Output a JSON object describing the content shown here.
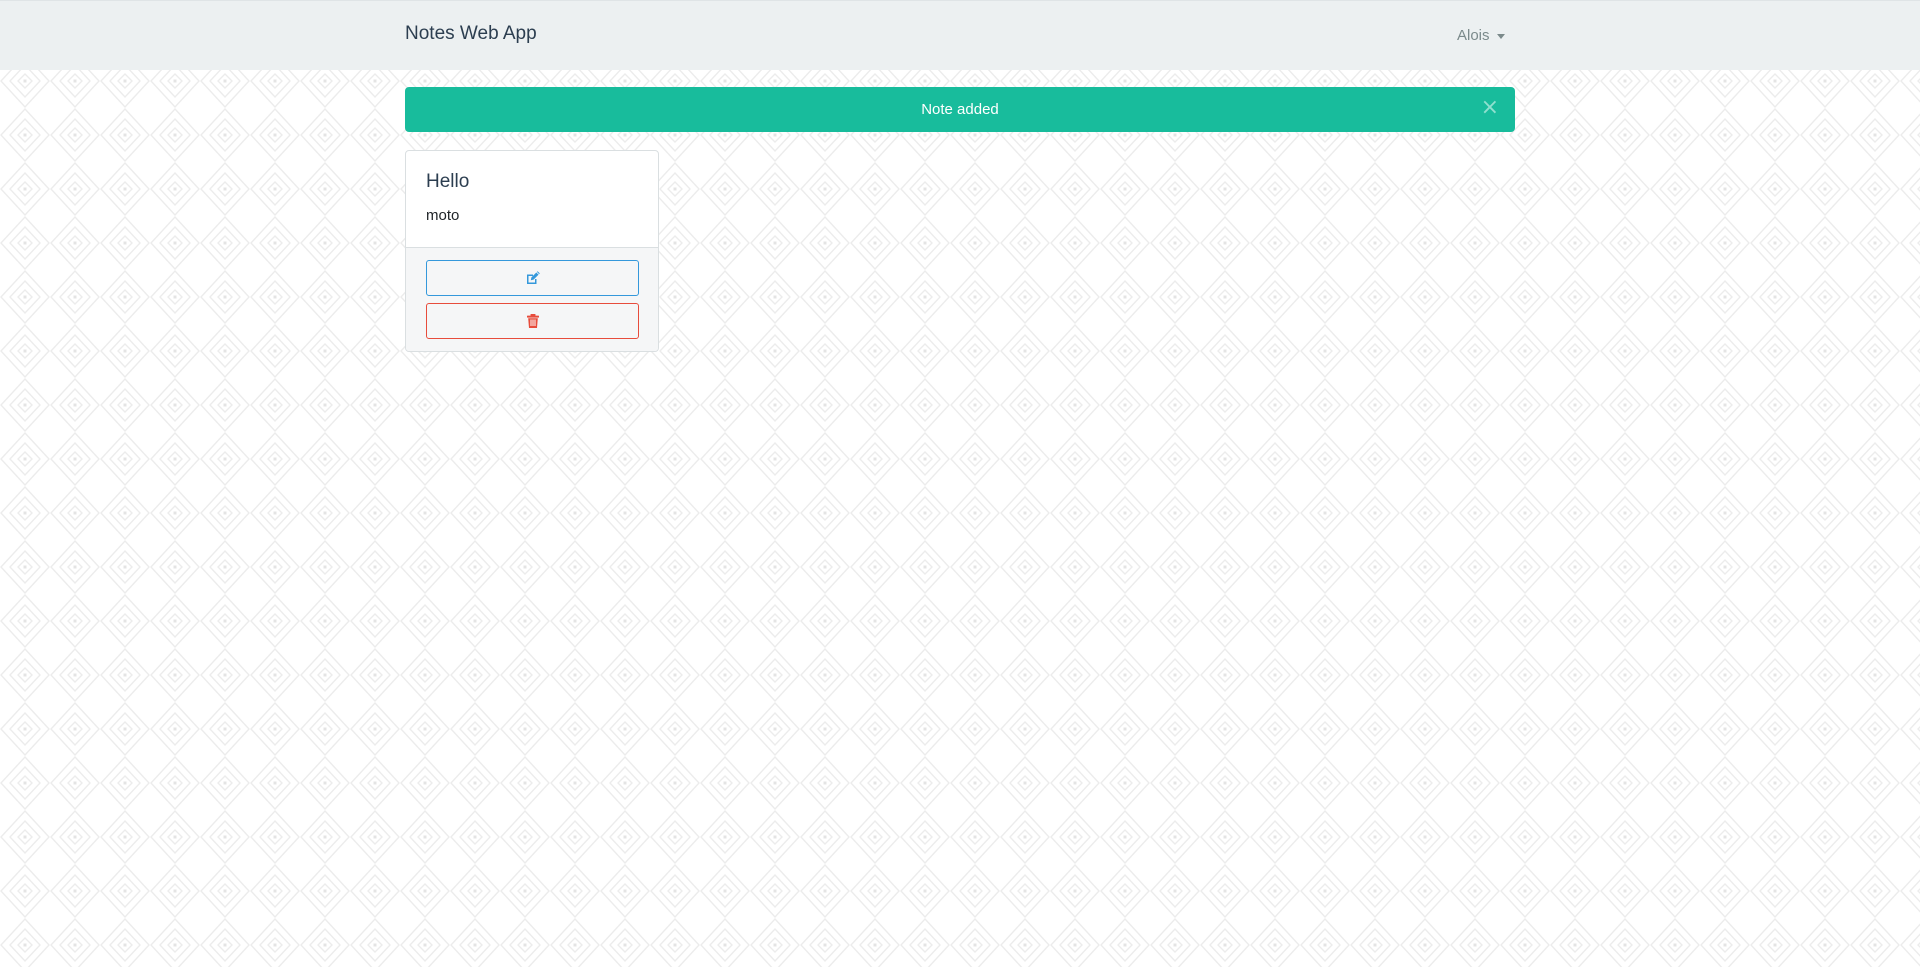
{
  "navbar": {
    "brand": "Notes Web App",
    "user": "Alois"
  },
  "alert": {
    "message": "Note added",
    "close_symbol": "×"
  },
  "notes": [
    {
      "title": "Hello",
      "text": "moto",
      "actions": [
        {
          "name": "edit",
          "icon": "edit-icon"
        },
        {
          "name": "delete",
          "icon": "trash-icon"
        }
      ]
    }
  ],
  "colors": {
    "navbar_bg": "#ecf0f1",
    "alert_bg": "#18bc9c",
    "edit_accent": "#3498db",
    "delete_accent": "#e74c3c"
  }
}
